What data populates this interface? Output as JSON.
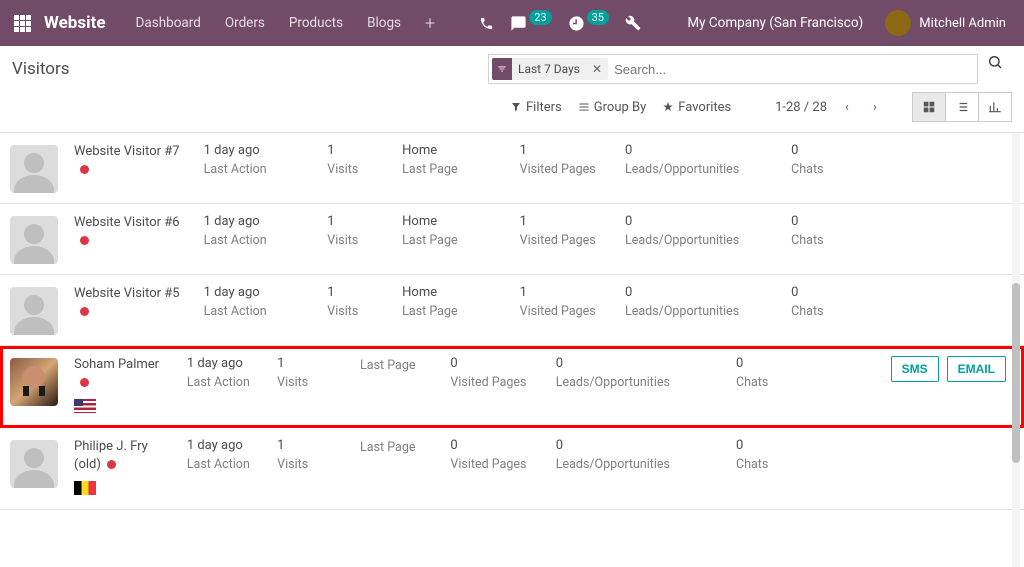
{
  "topbar": {
    "brand": "Website",
    "nav": [
      "Dashboard",
      "Orders",
      "Products",
      "Blogs"
    ],
    "chat_count": "23",
    "sched_count": "35",
    "company": "My Company (San Francisco)",
    "user": "Mitchell Admin"
  },
  "page": {
    "title": "Visitors",
    "filter_facet": "Last 7 Days",
    "search_placeholder": "Search...",
    "filters_label": "Filters",
    "groupby_label": "Group By",
    "favorites_label": "Favorites",
    "pager": "1-28 / 28"
  },
  "labels": {
    "last_action": "Last Action",
    "visits": "Visits",
    "last_page": "Last Page",
    "visited_pages": "Visited Pages",
    "leads": "Leads/Opportunities",
    "chats": "Chats",
    "sms": "SMS",
    "email": "EMAIL"
  },
  "visitors": [
    {
      "name": "Website Visitor #7",
      "time": "1 day ago",
      "visits": "1",
      "last_page": "Home",
      "pages": "1",
      "leads": "0",
      "chats": "0",
      "flag": "",
      "photo": false,
      "highlight": false,
      "compact": false,
      "last_page_empty": false
    },
    {
      "name": "Website Visitor #6",
      "time": "1 day ago",
      "visits": "1",
      "last_page": "Home",
      "pages": "1",
      "leads": "0",
      "chats": "0",
      "flag": "",
      "photo": false,
      "highlight": false,
      "compact": false,
      "last_page_empty": false
    },
    {
      "name": "Website Visitor #5",
      "time": "1 day ago",
      "visits": "1",
      "last_page": "Home",
      "pages": "1",
      "leads": "0",
      "chats": "0",
      "flag": "",
      "photo": false,
      "highlight": false,
      "compact": false,
      "last_page_empty": false
    },
    {
      "name": "Soham Palmer",
      "time": "1 day ago",
      "visits": "1",
      "last_page": "",
      "pages": "0",
      "leads": "0",
      "chats": "0",
      "flag": "us",
      "photo": true,
      "highlight": true,
      "compact": true,
      "last_page_empty": true
    },
    {
      "name": "Philipe J. Fry (old)",
      "time": "1 day ago",
      "visits": "1",
      "last_page": "",
      "pages": "0",
      "leads": "0",
      "chats": "0",
      "flag": "be",
      "photo": false,
      "highlight": false,
      "compact": true,
      "last_page_empty": true
    }
  ]
}
